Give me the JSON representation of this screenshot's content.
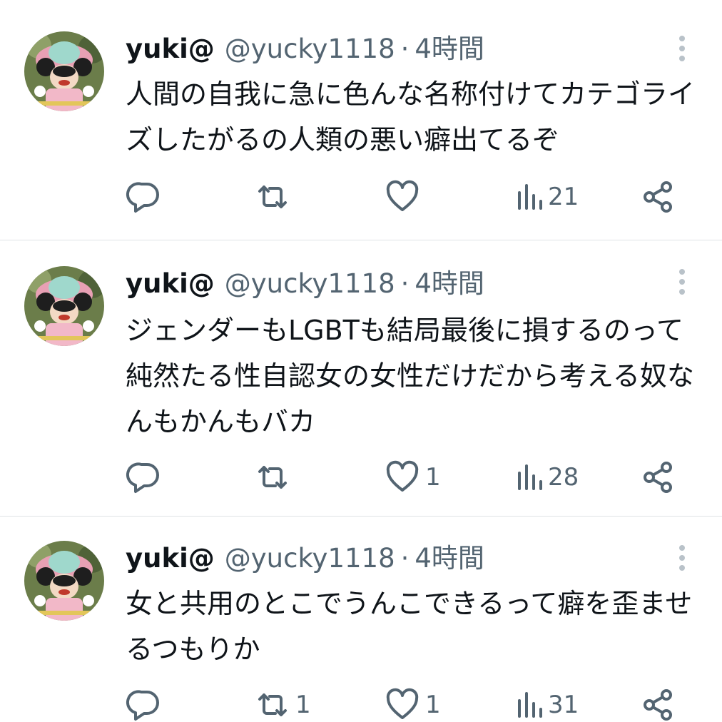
{
  "tweets": [
    {
      "name": "yuki@",
      "handle": "@yucky1118",
      "dot": "·",
      "time": "4時間",
      "text": "人間の自我に急に色んな名称付けてカテゴライズしたがるの人類の悪い癖出てるぞ",
      "replies": "",
      "retweets": "",
      "likes": "",
      "views": "21"
    },
    {
      "name": "yuki@",
      "handle": "@yucky1118",
      "dot": "·",
      "time": "4時間",
      "text": "ジェンダーもLGBTも結局最後に損するのって純然たる性自認女の女性だけだから考える奴なんもかんもバカ",
      "replies": "",
      "retweets": "",
      "likes": "1",
      "views": "28"
    },
    {
      "name": "yuki@",
      "handle": "@yucky1118",
      "dot": "·",
      "time": "4時間",
      "text": "女と共用のとこでうんこできるって癖を歪ませるつもりか",
      "replies": "",
      "retweets": "1",
      "likes": "1",
      "views": "31"
    }
  ],
  "icons": {
    "reply": "reply-icon",
    "retweet": "retweet-icon",
    "like": "heart-icon",
    "views": "views-icon",
    "share": "share-icon",
    "more": "more-icon"
  },
  "colors": {
    "text_primary": "#0f1419",
    "text_secondary": "#536471",
    "divider": "#dfe3e6",
    "background": "#ffffff"
  }
}
